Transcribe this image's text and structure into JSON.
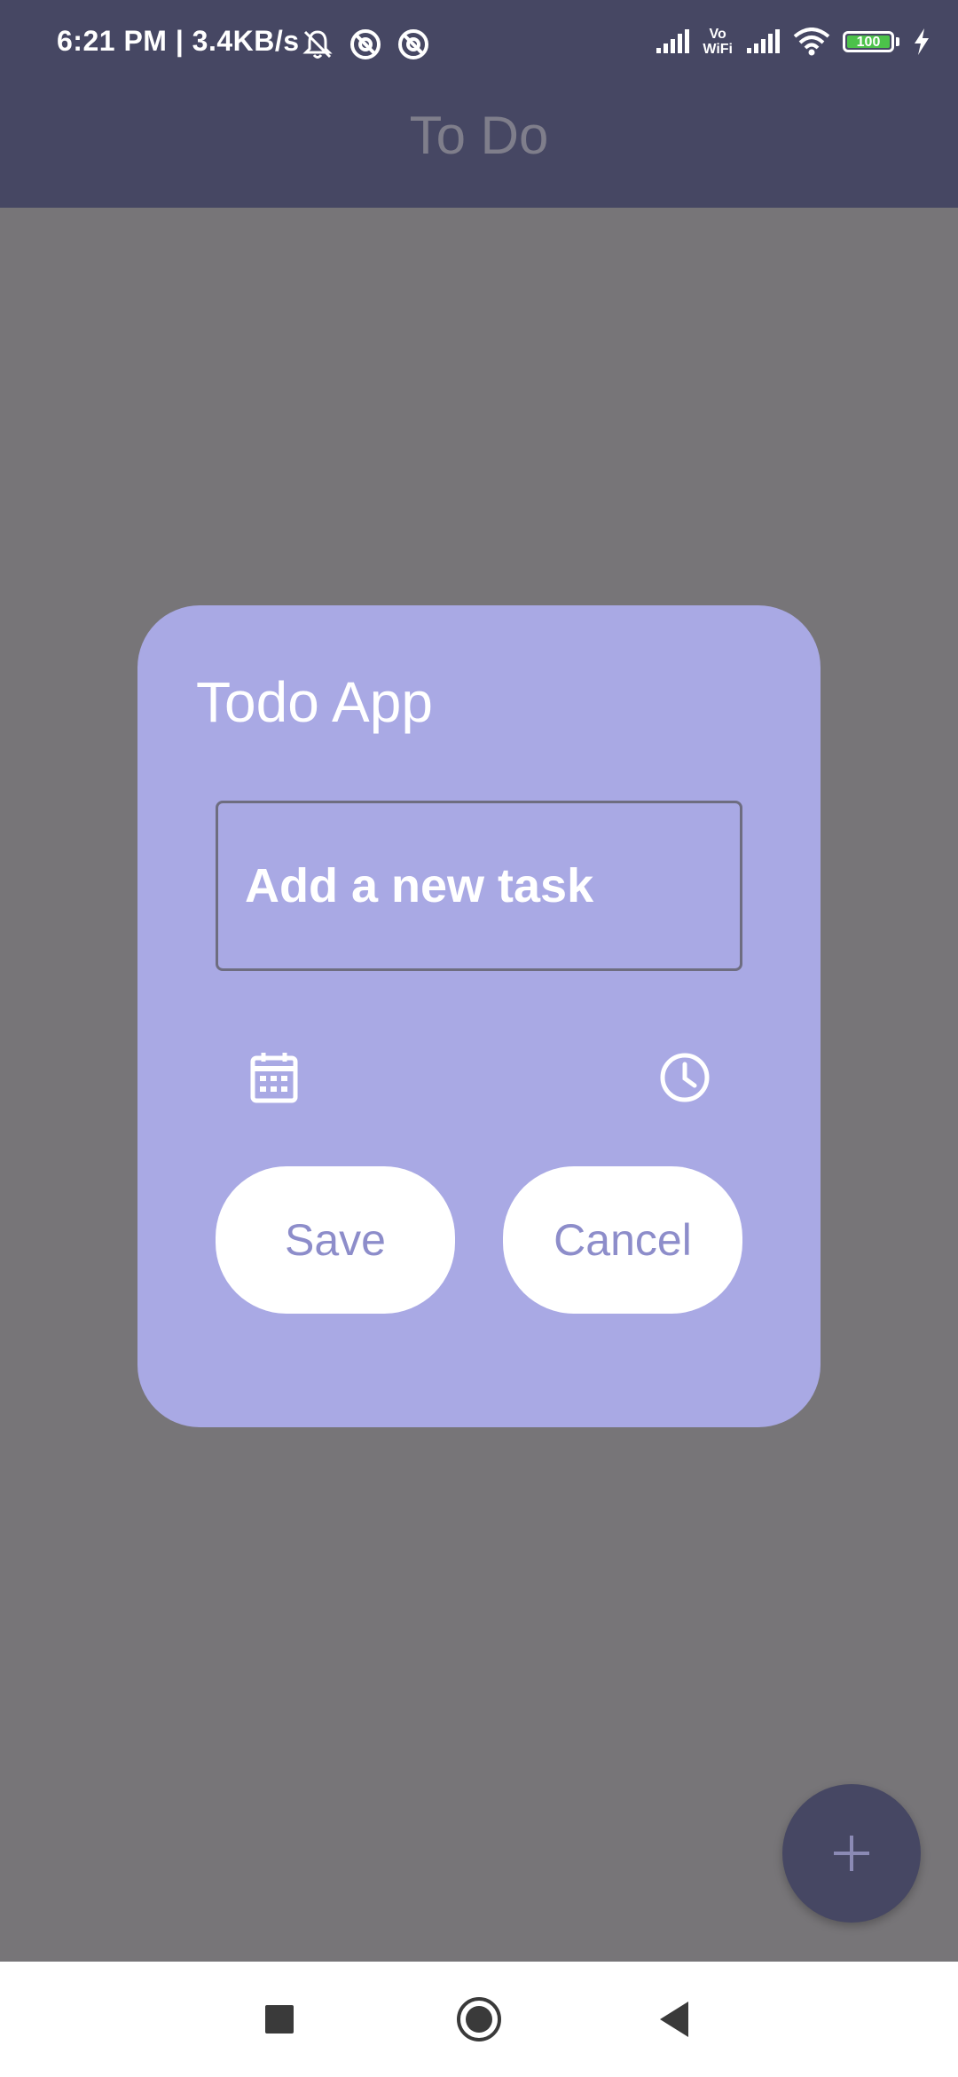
{
  "status_bar": {
    "time_speed": "6:21 PM | 3.4KB/s",
    "vowifi": [
      "Vo",
      "WiFi"
    ],
    "battery": "100",
    "icons": [
      "mute-icon",
      "vpn-icon",
      "vpn-icon",
      "signal-icon",
      "vowifi-icon",
      "signal-icon",
      "wifi-icon",
      "battery-icon",
      "charging-icon"
    ]
  },
  "app_bar": {
    "title": "To Do"
  },
  "dialog": {
    "title": "Todo App",
    "task_placeholder": "Add a new task",
    "task_value": "",
    "date_icon": "calendar-icon",
    "time_icon": "clock-icon",
    "save_label": "Save",
    "cancel_label": "Cancel"
  },
  "fab": {
    "icon": "plus-icon",
    "label": "+"
  },
  "nav": {
    "icons": [
      "recents-square-icon",
      "home-circle-icon",
      "back-triangle-icon"
    ]
  },
  "colors": {
    "bar": "#464763",
    "scrim": "#777578",
    "dialog": "#a9a9e4",
    "button_text": "#8d8dca"
  }
}
